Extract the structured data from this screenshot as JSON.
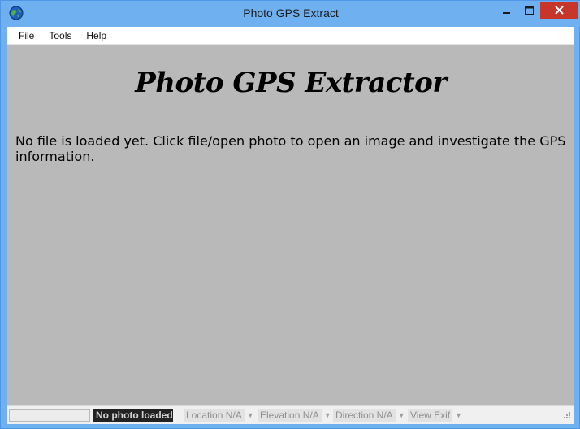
{
  "window": {
    "title": "Photo GPS Extract",
    "icon": "globe-icon",
    "controls": [
      "minimize-icon",
      "maximize-icon",
      "close-icon"
    ]
  },
  "menubar": {
    "items": [
      {
        "label": "File"
      },
      {
        "label": "Tools"
      },
      {
        "label": "Help"
      }
    ]
  },
  "content": {
    "headline": "Photo GPS Extractor",
    "message": "No file is loaded yet. Click file/open photo to open an image and investigate the GPS information."
  },
  "statusbar": {
    "photo_status": "No photo loaded",
    "location": "Location N/A",
    "elevation": "Elevation N/A",
    "direction": "Direction N/A",
    "view_exif": "View Exif",
    "dropdown_icon": "chevron-down-icon"
  },
  "colors": {
    "titlebar": "#6fb0f0",
    "close_button": "#c7352b",
    "content_bg": "#b9b9b9",
    "status_dark_bg": "#222222"
  }
}
